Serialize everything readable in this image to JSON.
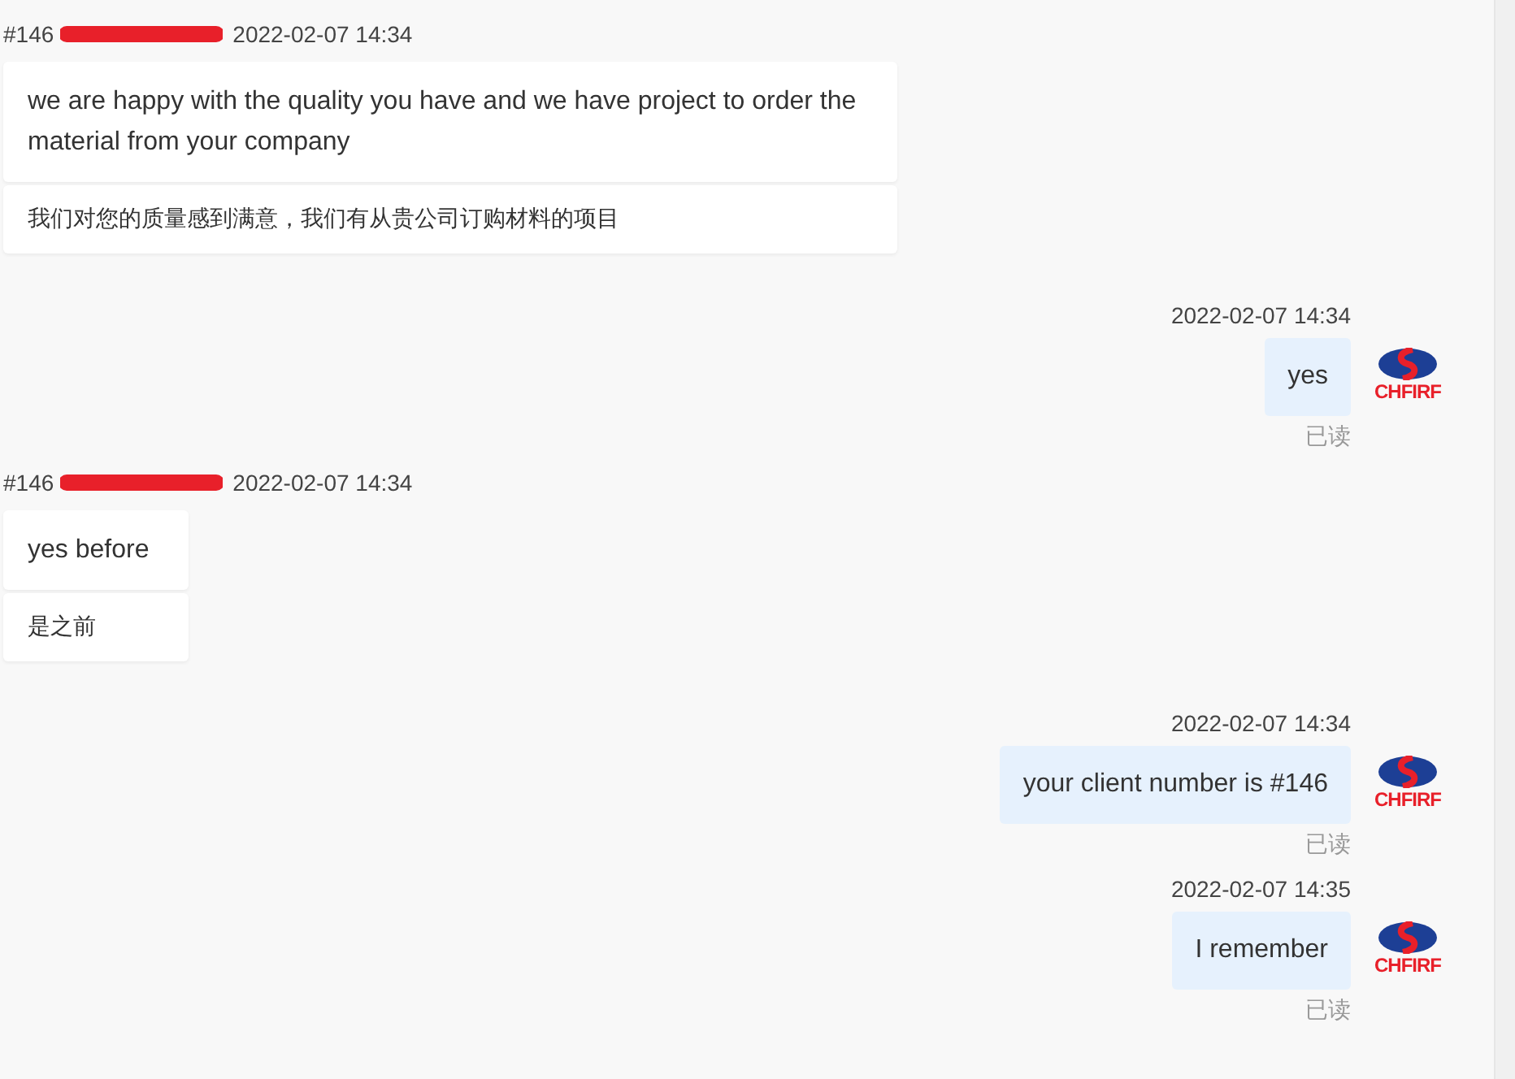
{
  "messages": [
    {
      "kind": "incoming",
      "sender": "#146",
      "redacted": true,
      "time": "2022-02-07 14:34",
      "text": "we are happy with the quality you have and we have project to order the material from your company",
      "translation": "我们对您的质量感到满意，我们有从贵公司订购材料的项目"
    },
    {
      "kind": "outgoing",
      "time": "2022-02-07 14:34",
      "text": "yes",
      "avatar_text": "CHFIRF",
      "status": "已读"
    },
    {
      "kind": "incoming",
      "sender": "#146",
      "redacted": true,
      "time": "2022-02-07 14:34",
      "text": "yes before",
      "translation": "是之前"
    },
    {
      "kind": "outgoing",
      "time": "2022-02-07 14:34",
      "text": "your client number is #146",
      "avatar_text": "CHFIRF",
      "status": "已读"
    },
    {
      "kind": "outgoing",
      "time": "2022-02-07 14:35",
      "text": "I remember",
      "avatar_text": "CHFIRF",
      "status": "已读"
    }
  ]
}
